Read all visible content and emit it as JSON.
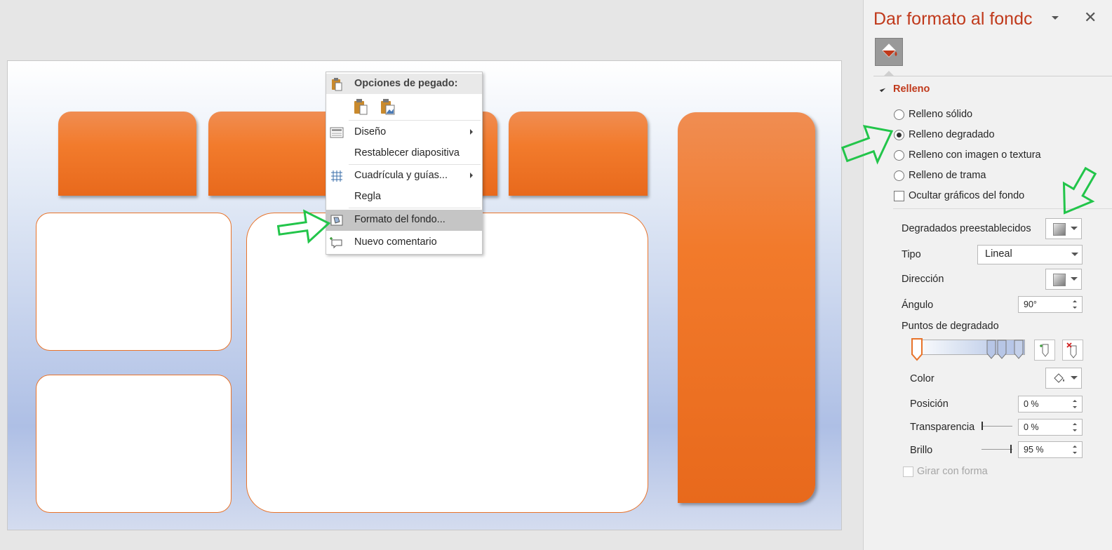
{
  "context_menu": {
    "paste_header": "Opciones de pegado:",
    "items": [
      {
        "label": "Diseño",
        "access_key": "ñ"
      },
      {
        "label": "Restablecer diapositiva",
        "access_key": "b"
      },
      {
        "label": "Cuadrícula y guías...",
        "access_key": "a"
      },
      {
        "label": "Regla",
        "access_key": "R"
      },
      {
        "label": "Formato del fondo...",
        "access_key": "F"
      },
      {
        "label": "Nuevo comentario",
        "access_key": "v"
      }
    ],
    "highlighted_item": "Formato del fondo..."
  },
  "pane": {
    "title": "Dar formato al fondc",
    "section_title": "Relleno",
    "fill_options": [
      {
        "label": "Relleno sólido",
        "selected": false
      },
      {
        "label": "Relleno degradado",
        "selected": true
      },
      {
        "label": "Relleno con imagen o textura",
        "selected": false
      },
      {
        "label": "Relleno de trama",
        "selected": false
      }
    ],
    "hide_background_label": "Ocultar gráficos del fondo",
    "presets_label": "Degradados preestablecidos",
    "type_label": "Tipo",
    "type_value": "Lineal",
    "direction_label": "Dirección",
    "angle_label": "Ángulo",
    "angle_value": "90°",
    "stops_label": "Puntos de degradado",
    "color_label": "Color",
    "position_label": "Posición",
    "position_value": "0 %",
    "transparency_label": "Transparencia",
    "transparency_value": "0 %",
    "brightness_label": "Brillo",
    "brightness_value": "95 %",
    "rotate_label": "Girar con forma"
  },
  "colors": {
    "accent_title": "#c0391b",
    "slide_orange": "#f27a2b",
    "annotation_green": "#22c54a"
  }
}
